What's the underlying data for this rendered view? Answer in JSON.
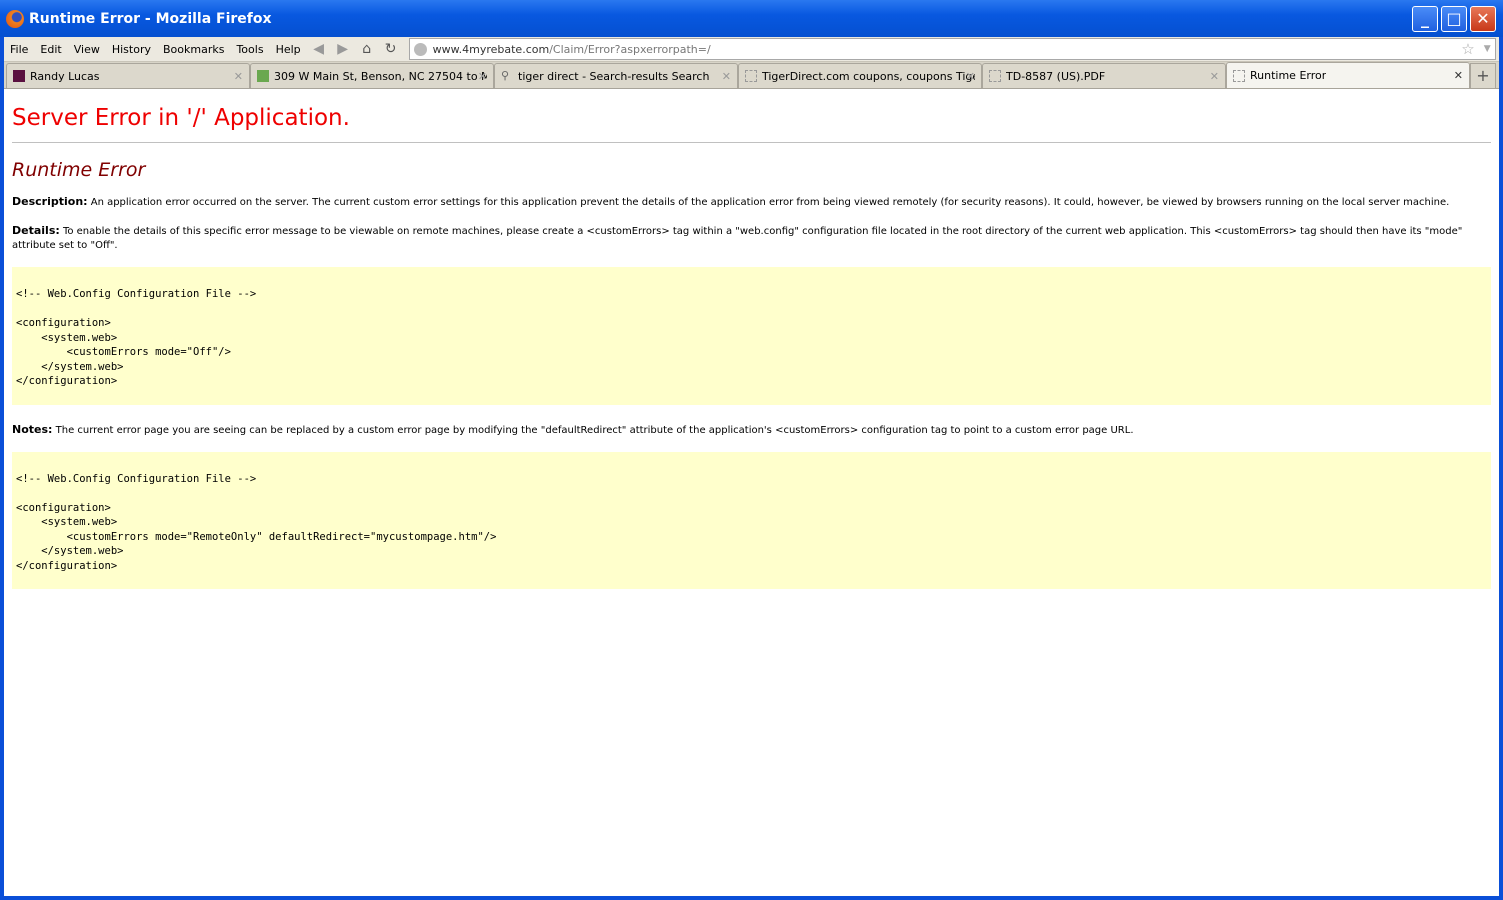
{
  "window": {
    "title": "Runtime Error - Mozilla Firefox"
  },
  "menu": [
    "File",
    "Edit",
    "View",
    "History",
    "Bookmarks",
    "Tools",
    "Help"
  ],
  "url": {
    "host": "www.4myrebate.com",
    "path": "/Claim/Error?aspxerrorpath=/"
  },
  "tabs": [
    {
      "label": "Randy Lucas",
      "icon": "site-favicon"
    },
    {
      "label": "309 W Main St, Benson, NC 27504 to M...",
      "icon": "maps-icon"
    },
    {
      "label": "tiger direct - Search-results Search",
      "icon": "search-icon"
    },
    {
      "label": "TigerDirect.com coupons, coupons Tige...",
      "icon": "blank-page-icon"
    },
    {
      "label": "TD-8587 (US).PDF",
      "icon": "blank-page-icon"
    },
    {
      "label": "Runtime Error",
      "icon": "blank-page-icon",
      "active": true
    }
  ],
  "page": {
    "heading": "Server Error in '/' Application.",
    "subheading": "Runtime Error",
    "description_label": "Description:",
    "description": " An application error occurred on the server. The current custom error settings for this application prevent the details of the application error from being viewed remotely (for security reasons). It could, however, be viewed by browsers running on the local server machine.",
    "details_label": "Details:",
    "details": " To enable the details of this specific error message to be viewable on remote machines, please create a <customErrors> tag within a \"web.config\" configuration file located in the root directory of the current web application. This <customErrors> tag should then have its \"mode\" attribute set to \"Off\".",
    "code1": "<!-- Web.Config Configuration File -->\n\n<configuration>\n    <system.web>\n        <customErrors mode=\"Off\"/>\n    </system.web>\n</configuration>",
    "notes_label": "Notes:",
    "notes": " The current error page you are seeing can be replaced by a custom error page by modifying the \"defaultRedirect\" attribute of the application's <customErrors> configuration tag to point to a custom error page URL.",
    "code2": "<!-- Web.Config Configuration File -->\n\n<configuration>\n    <system.web>\n        <customErrors mode=\"RemoteOnly\" defaultRedirect=\"mycustompage.htm\"/>\n    </system.web>\n</configuration>"
  }
}
